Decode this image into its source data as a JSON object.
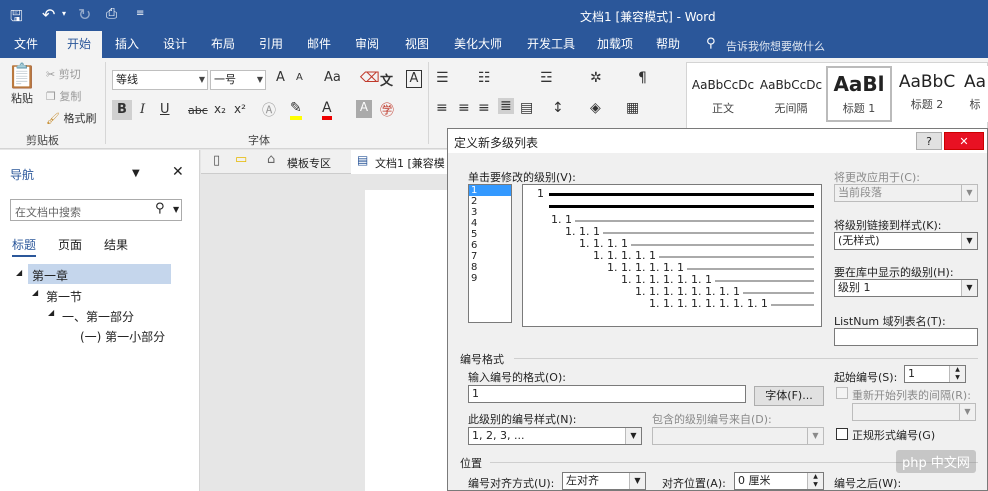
{
  "window": {
    "title": "文档1 [兼容模式] - Word"
  },
  "tabs": [
    "文件",
    "开始",
    "插入",
    "设计",
    "布局",
    "引用",
    "邮件",
    "审阅",
    "视图",
    "美化大师",
    "开发工具",
    "加载项",
    "帮助"
  ],
  "tell_me": "告诉我你想要做什么",
  "clipboard": {
    "paste": "粘贴",
    "cut": "剪切",
    "copy": "复制",
    "format_painter": "格式刷",
    "group": "剪贴板"
  },
  "font": {
    "name": "等线",
    "size": "一号",
    "group": "字体",
    "grow": "A",
    "shrink": "A",
    "case": "Aa",
    "bold": "B",
    "italic": "I",
    "underline": "U",
    "strike": "abc",
    "sub": "x₂",
    "sup": "x²"
  },
  "styles": [
    {
      "sample": "AaBbCcDc",
      "name": "正文"
    },
    {
      "sample": "AaBbCcDc",
      "name": "无间隔"
    },
    {
      "sample": "AaBl",
      "name": "标题 1"
    },
    {
      "sample": "AaBbC",
      "name": "标题 2"
    },
    {
      "sample": "Aa",
      "name": "标"
    }
  ],
  "nav": {
    "title": "导航",
    "search_placeholder": "在文档中搜索",
    "tabs": [
      "标题",
      "页面",
      "结果"
    ],
    "tree": [
      {
        "label": "第一章",
        "level": 0
      },
      {
        "label": "第一节",
        "level": 1
      },
      {
        "label": "一、第一部分",
        "level": 2
      },
      {
        "label": "(一) 第一小部分",
        "level": 3
      }
    ]
  },
  "doc_tabs": {
    "templates": "模板专区",
    "doc": "文档1 [兼容模"
  },
  "dialog": {
    "title": "定义新多级列表",
    "help": "?",
    "level_label": "单击要修改的级别(V):",
    "levels": [
      "1",
      "2",
      "3",
      "4",
      "5",
      "6",
      "7",
      "8",
      "9"
    ],
    "preview": [
      "1",
      "1. 1",
      "1. 1. 1",
      "1. 1. 1. 1",
      "1. 1. 1. 1. 1",
      "1. 1. 1. 1. 1. 1",
      "1. 1. 1. 1. 1. 1. 1",
      "1. 1. 1. 1. 1. 1. 1. 1",
      "1. 1. 1. 1. 1. 1. 1. 1. 1"
    ],
    "apply_to_label": "将更改应用于(C):",
    "apply_to_value": "当前段落",
    "link_style_label": "将级别链接到样式(K):",
    "link_style_value": "(无样式)",
    "gallery_level_label": "要在库中显示的级别(H):",
    "gallery_level_value": "级别 1",
    "listnum_label": "ListNum 域列表名(T):",
    "listnum_value": "",
    "numformat_section": "编号格式",
    "enter_format_label": "输入编号的格式(O):",
    "enter_format_value": "1",
    "font_button": "字体(F)...",
    "number_style_label": "此级别的编号样式(N):",
    "number_style_value": "1, 2, 3, ...",
    "include_from_label": "包含的级别编号来自(D):",
    "start_at_label": "起始编号(S):",
    "start_at_value": "1",
    "restart_label": "重新开始列表的间隔(R):",
    "legal_label": "正规形式编号(G)",
    "position_section": "位置",
    "alignment_label": "编号对齐方式(U):",
    "alignment_value": "左对齐",
    "aligned_at_label": "对齐位置(A):",
    "aligned_at_value": "0 厘米",
    "follow_label": "编号之后(W):"
  },
  "watermark": "php 中文网"
}
